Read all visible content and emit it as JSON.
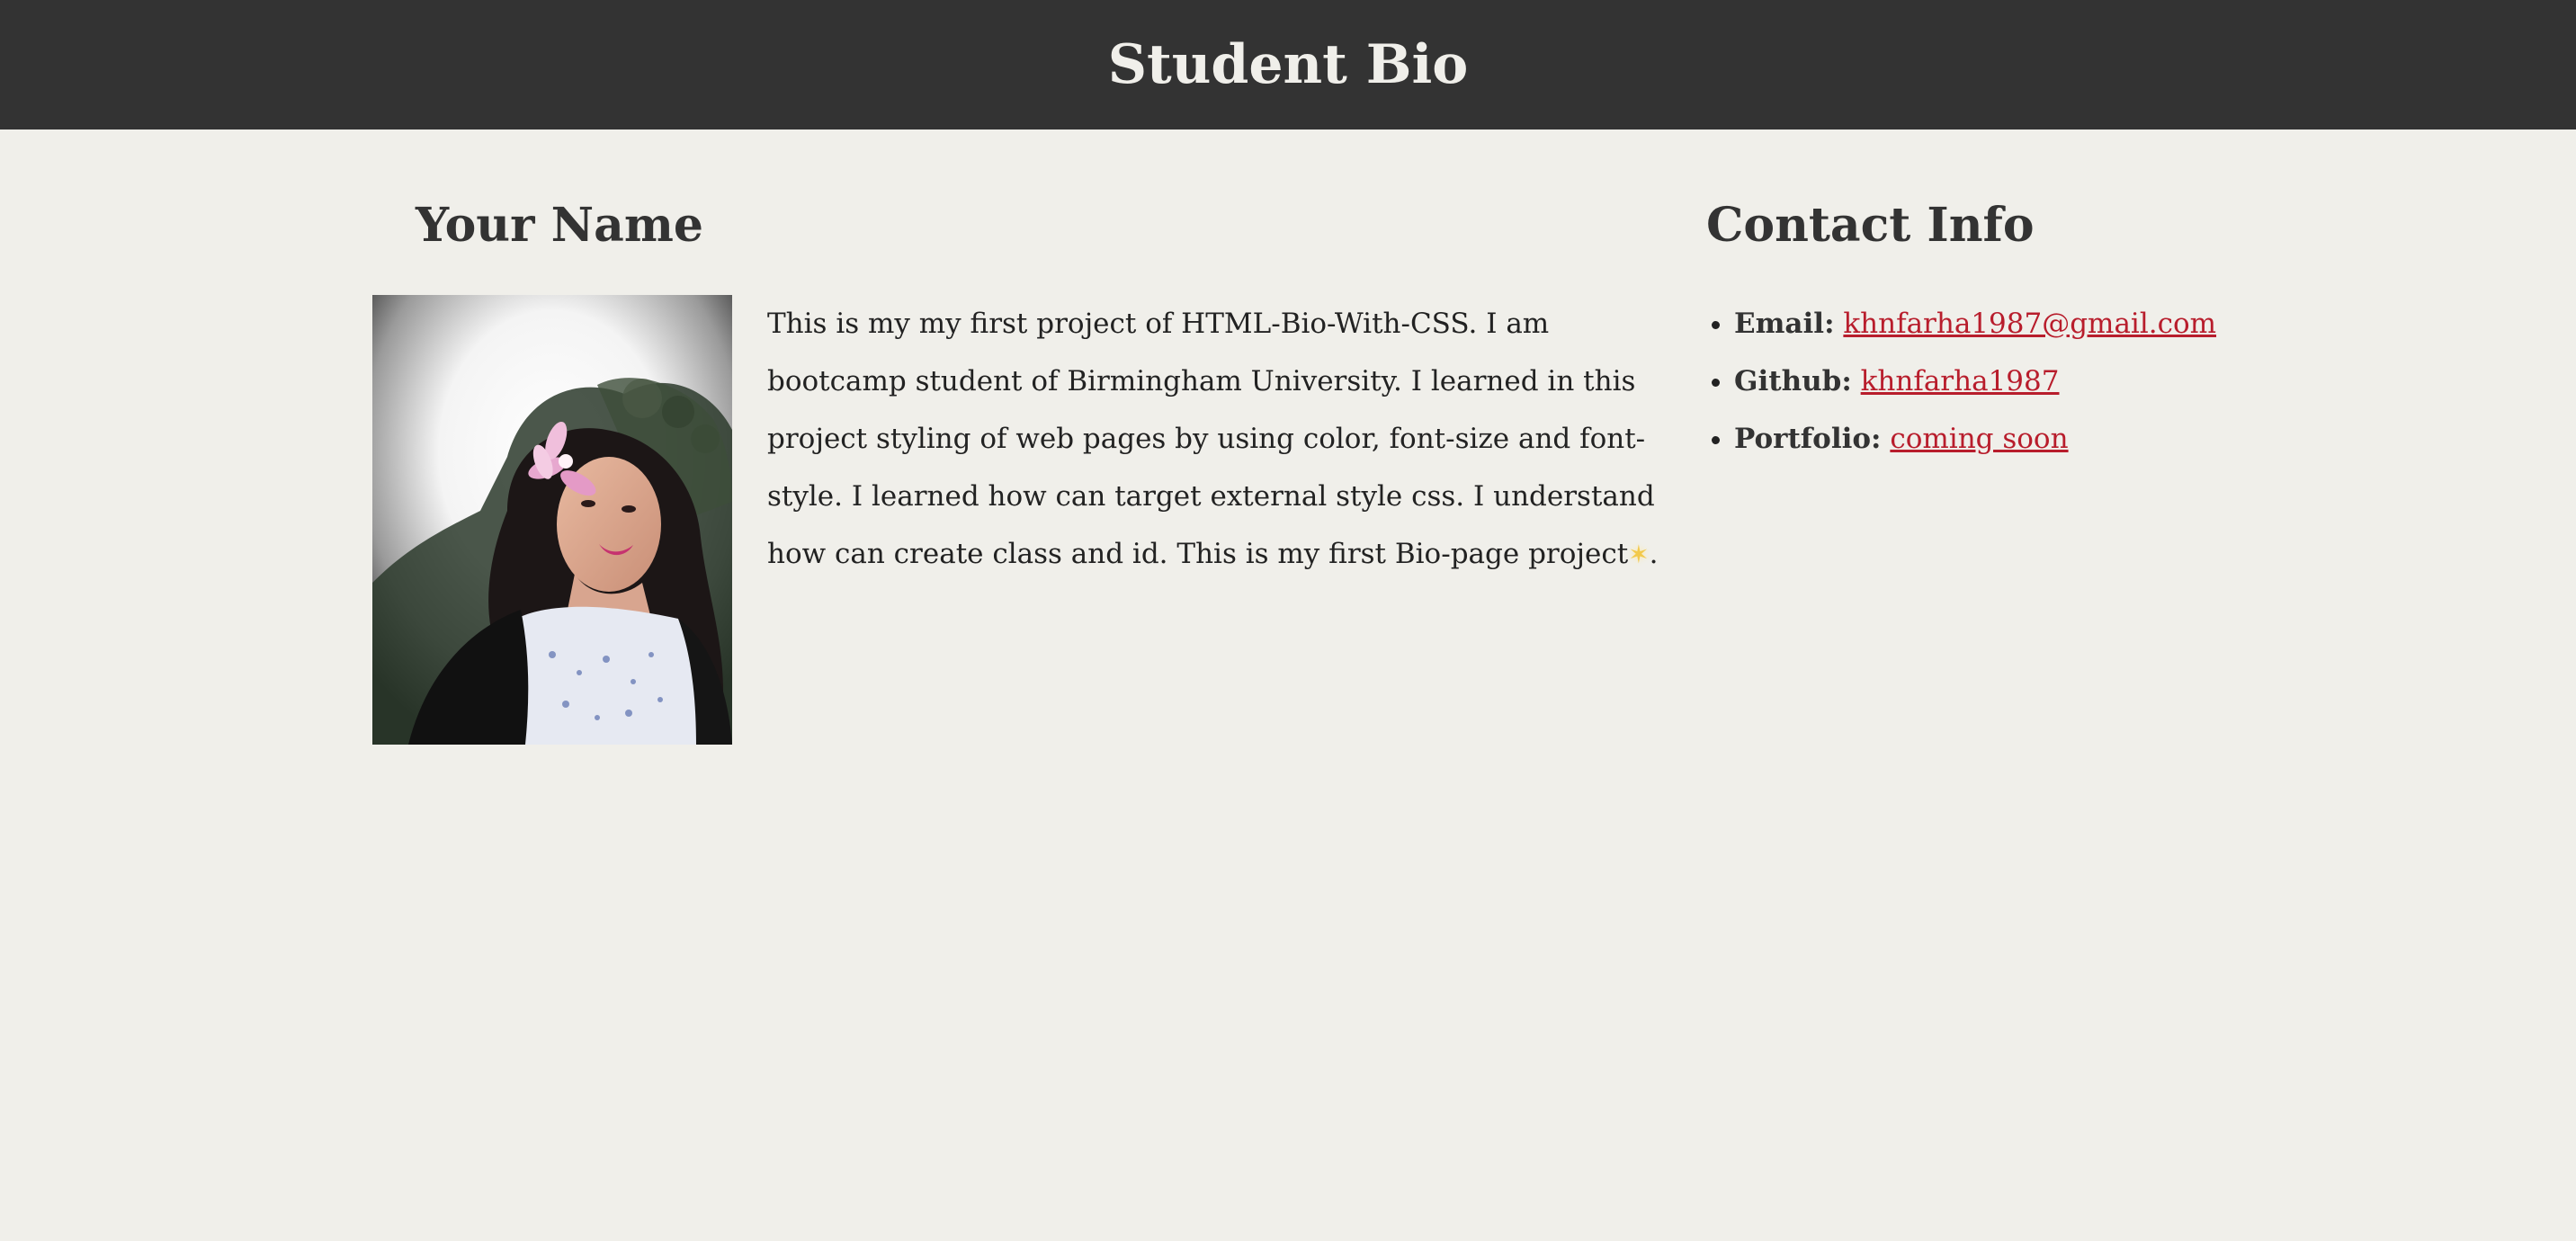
{
  "header": {
    "title": "Student Bio"
  },
  "profile": {
    "name": "Your Name",
    "bio_before_icon": "This is my my first project of HTML-Bio-With-CSS. I am bootcamp student of Birmingham University. I learned in this project styling of web pages by using color, font-size and font-style. I learned how can target external style css. I understand how can create class and id. This is my first Bio-page project",
    "bio_icon": "star-icon",
    "bio_after_icon": "."
  },
  "contact": {
    "heading": "Contact Info",
    "items": [
      {
        "label": "Email:",
        "value": "khnfarha1987@gmail.com"
      },
      {
        "label": "Github:",
        "value": "khnfarha1987"
      },
      {
        "label": "Portfolio:",
        "value": "coming soon"
      }
    ]
  },
  "colors": {
    "header_bg": "#333333",
    "page_bg": "#f0efea",
    "link": "#b81d2c"
  }
}
